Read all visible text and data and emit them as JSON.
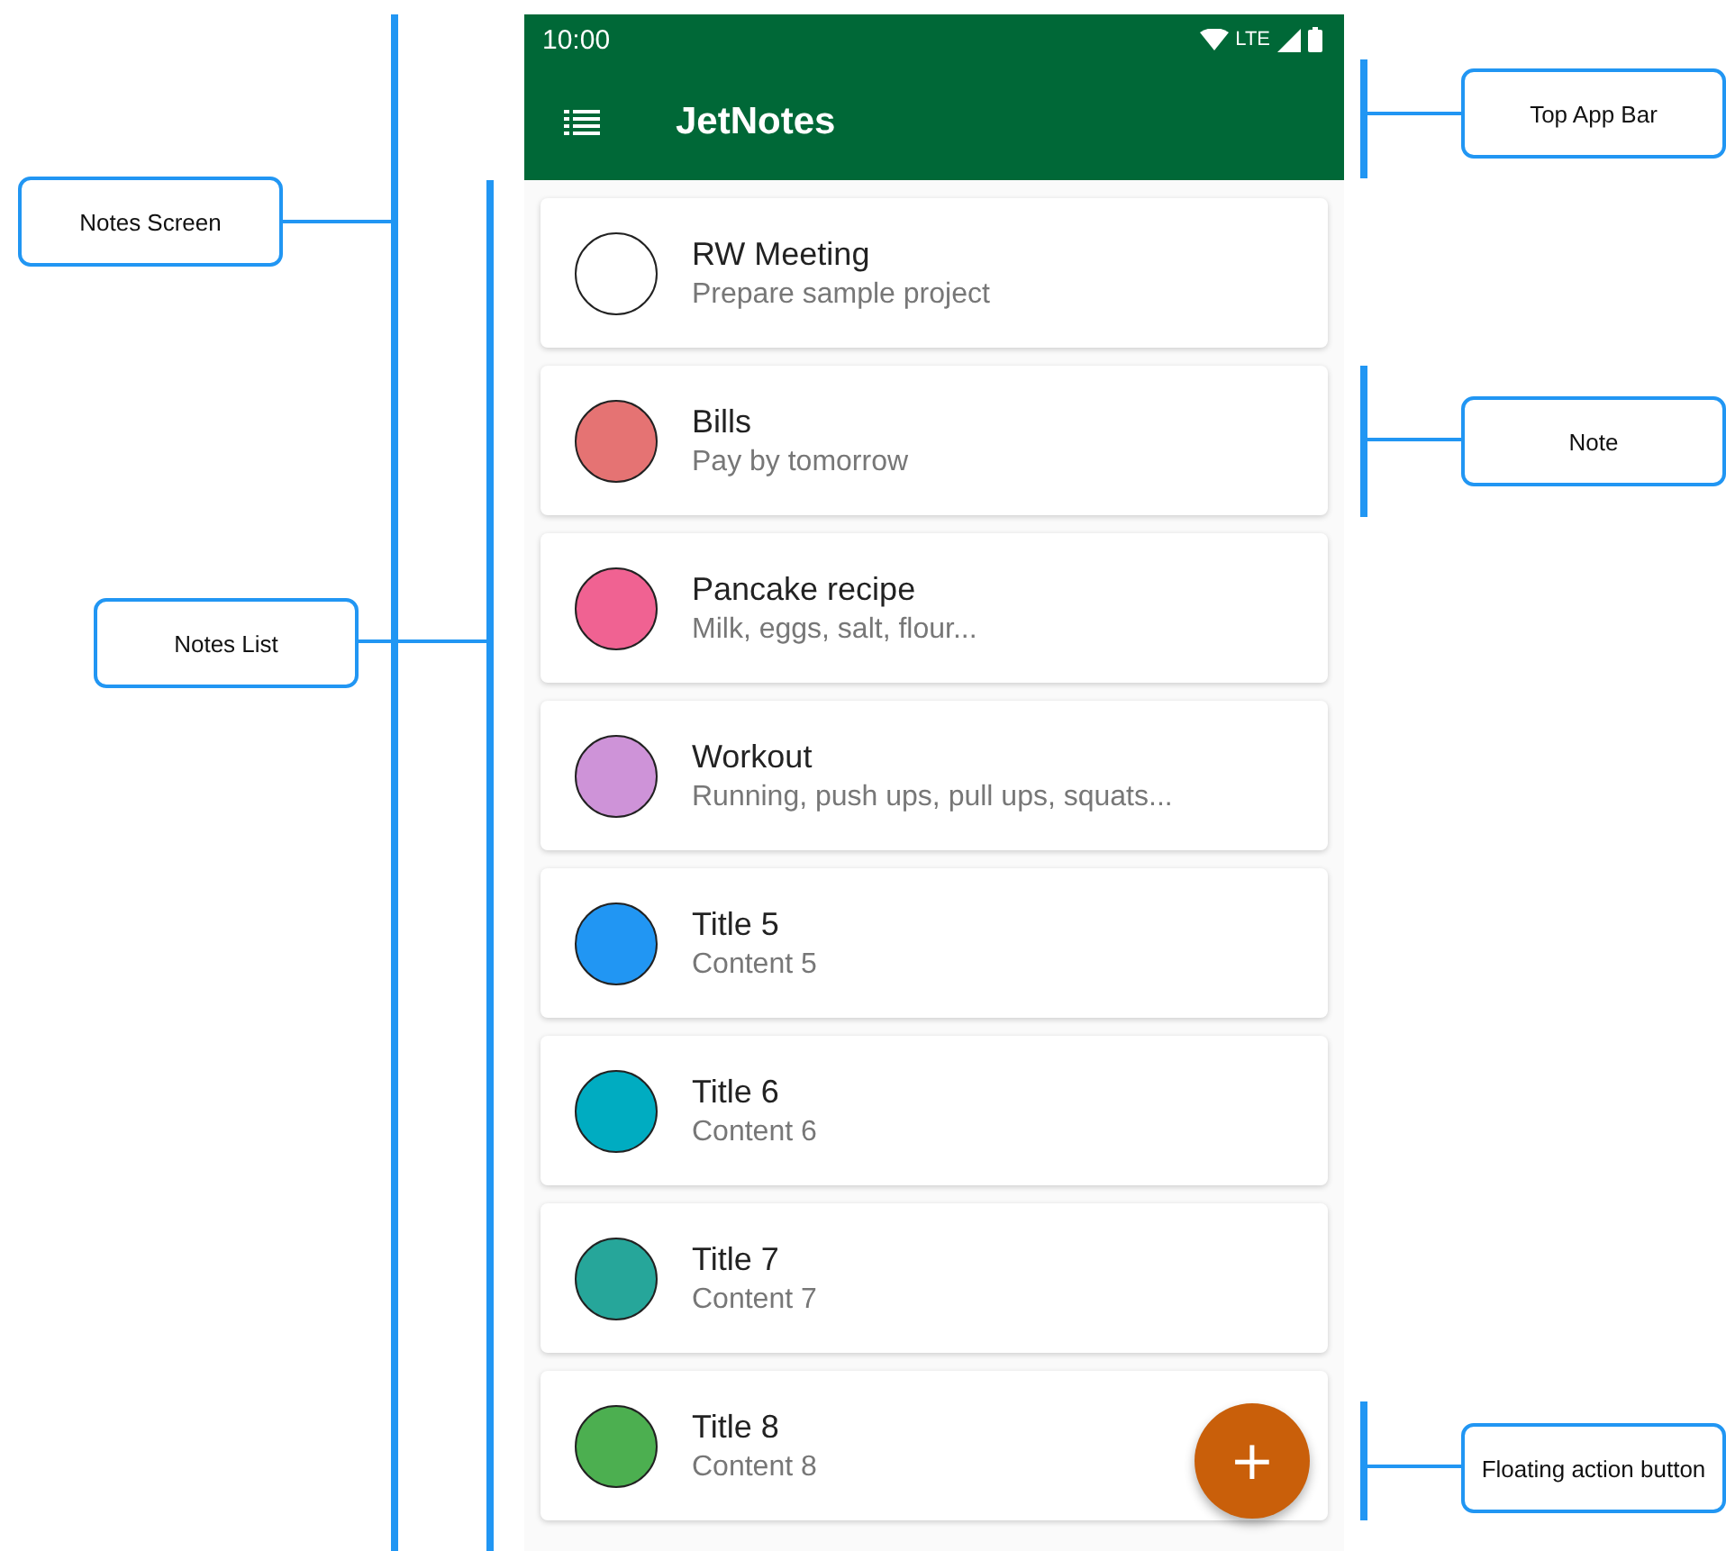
{
  "status_bar": {
    "time": "10:00",
    "network": "LTE"
  },
  "app_bar": {
    "title": "JetNotes"
  },
  "notes": [
    {
      "title": "RW Meeting",
      "content": "Prepare sample project",
      "color": "#ffffff"
    },
    {
      "title": "Bills",
      "content": "Pay by tomorrow",
      "color": "#e57373"
    },
    {
      "title": "Pancake recipe",
      "content": "Milk, eggs, salt, flour...",
      "color": "#f06292"
    },
    {
      "title": "Workout",
      "content": "Running, push ups, pull ups, squats...",
      "color": "#ce93d8"
    },
    {
      "title": "Title 5",
      "content": "Content 5",
      "color": "#2196f3"
    },
    {
      "title": "Title 6",
      "content": "Content 6",
      "color": "#00acc1"
    },
    {
      "title": "Title 7",
      "content": "Content 7",
      "color": "#26a69a"
    },
    {
      "title": "Title 8",
      "content": "Content 8",
      "color": "#4caf50"
    }
  ],
  "fab": {
    "label": "+"
  },
  "callouts": [
    {
      "label": "Notes Screen"
    },
    {
      "label": "Notes List"
    },
    {
      "label": "Top App Bar"
    },
    {
      "label": "Note"
    },
    {
      "label": "Floating action button"
    }
  ]
}
